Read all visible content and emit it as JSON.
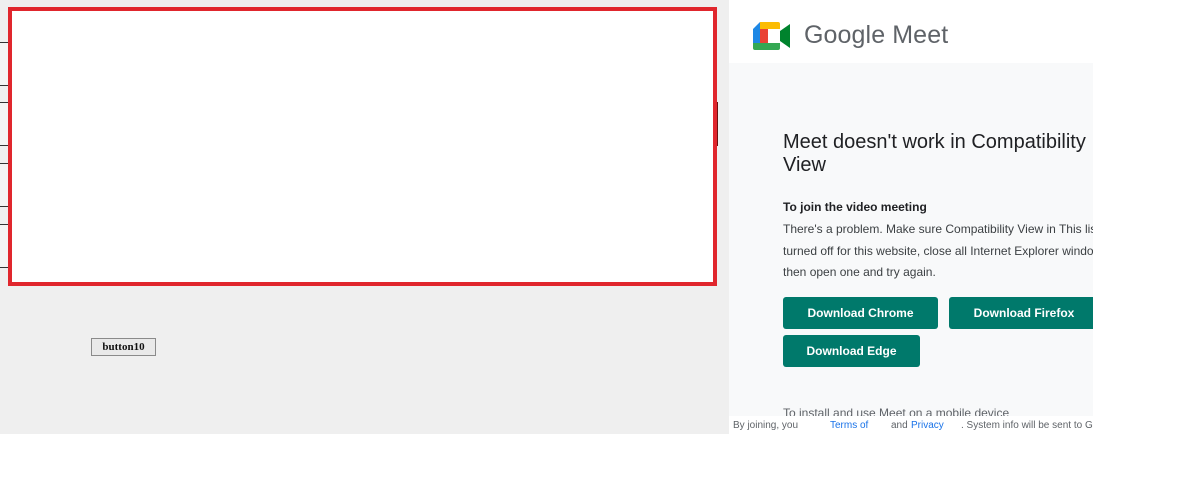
{
  "host_app": {
    "legacy_button_label": "button10"
  },
  "meet": {
    "brand_name": "Google Meet",
    "title": "Meet doesn't work in Compatibility View",
    "subhead": "To join the video meeting",
    "description": "There's a problem. Make sure Compatibility View in This list is turned off for this website, close all Internet Explorer windows, then open one and try again.",
    "buttons": {
      "chrome": "Download Chrome",
      "firefox": "Download Firefox",
      "edge": "Download Edge"
    },
    "cutoff_text": "To install and use Meet on a mobile device",
    "footer": {
      "text_1": "By joining, you",
      "terms_link": "Terms of",
      "text_2": "and",
      "privacy_link": "Privacy",
      "text_3": ". System info will be sent to Google"
    },
    "colors": {
      "accent": "#00796b",
      "frame_border": "#e0262d"
    },
    "icons": {
      "logo": "google-meet-camera-icon"
    }
  }
}
